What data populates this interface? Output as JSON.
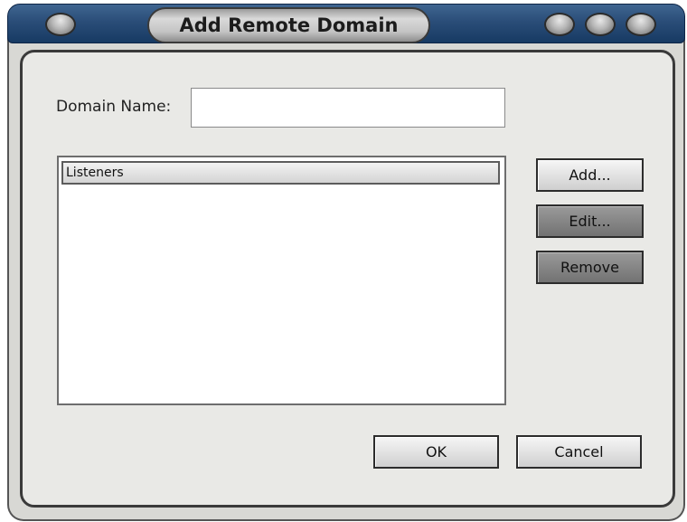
{
  "window": {
    "title": "Add Remote Domain"
  },
  "form": {
    "domain_name_label": "Domain Name:",
    "domain_name_value": "",
    "domain_name_placeholder": ""
  },
  "listeners": {
    "header": "Listeners",
    "items": []
  },
  "buttons": {
    "add": "Add...",
    "edit": "Edit...",
    "remove": "Remove",
    "ok": "OK",
    "cancel": "Cancel"
  },
  "colors": {
    "titlebar": "#2a4d78",
    "window_body": "#e9e9e6",
    "button_light": "#e4e4e4",
    "button_dark": "#858585"
  },
  "icons": {
    "window_menu": "window-menu-orb-icon",
    "minimize": "minimize-orb-icon",
    "maximize": "maximize-orb-icon",
    "close": "close-orb-icon"
  }
}
